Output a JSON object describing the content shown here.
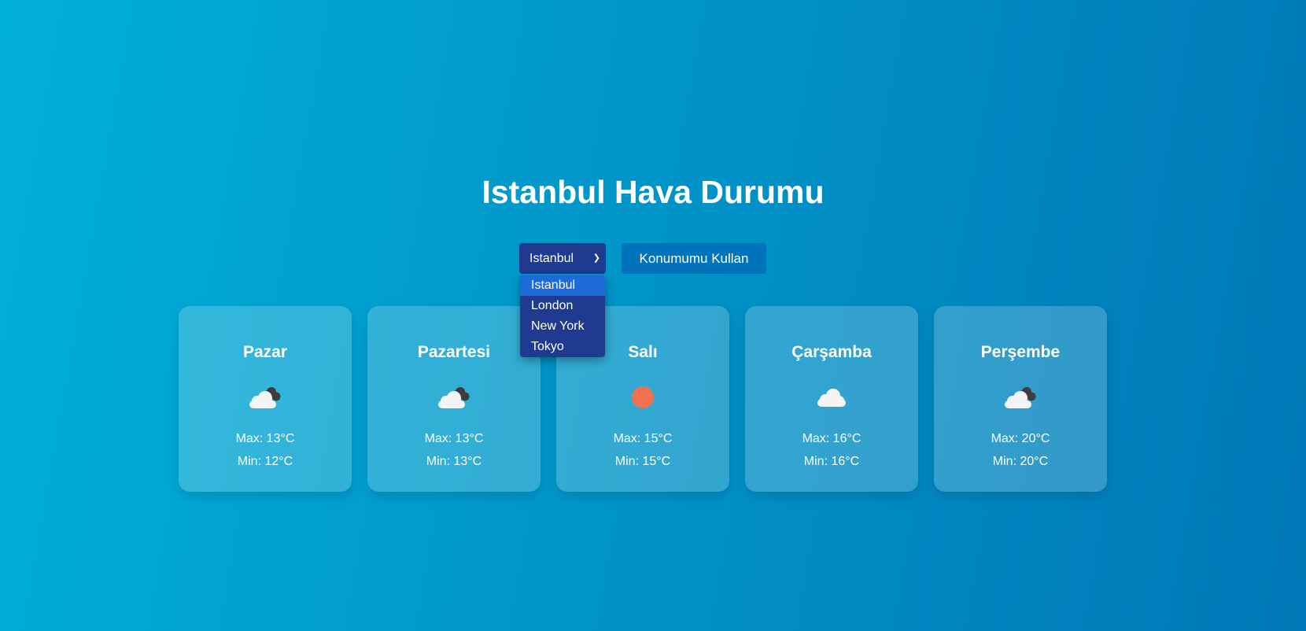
{
  "page": {
    "title": "Istanbul Hava Durumu"
  },
  "controls": {
    "city_select": {
      "selected": "Istanbul",
      "options": [
        "Istanbul",
        "London",
        "New York",
        "Tokyo"
      ]
    },
    "location_button_label": "Konumumu Kullan"
  },
  "forecast": [
    {
      "day": "Pazar",
      "icon": "cloud-dark-cloud-icon",
      "max": "Max: 13°C",
      "min": "Min: 12°C"
    },
    {
      "day": "Pazartesi",
      "icon": "cloud-dark-cloud-icon",
      "max": "Max: 13°C",
      "min": "Min: 13°C"
    },
    {
      "day": "Salı",
      "icon": "sun-icon",
      "max": "Max: 15°C",
      "min": "Min: 15°C"
    },
    {
      "day": "Çarşamba",
      "icon": "cloud-icon",
      "max": "Max: 16°C",
      "min": "Min: 16°C"
    },
    {
      "day": "Perşembe",
      "icon": "cloud-dark-cloud-icon",
      "max": "Max: 20°C",
      "min": "Min: 20°C"
    }
  ],
  "colors": {
    "background_start": "#01b0da",
    "background_end": "#0077b6",
    "select_bg": "#1f3a8f",
    "button_bg": "#0073bb",
    "selected_option_bg": "#1e6ad8",
    "sun": "#f07050"
  }
}
